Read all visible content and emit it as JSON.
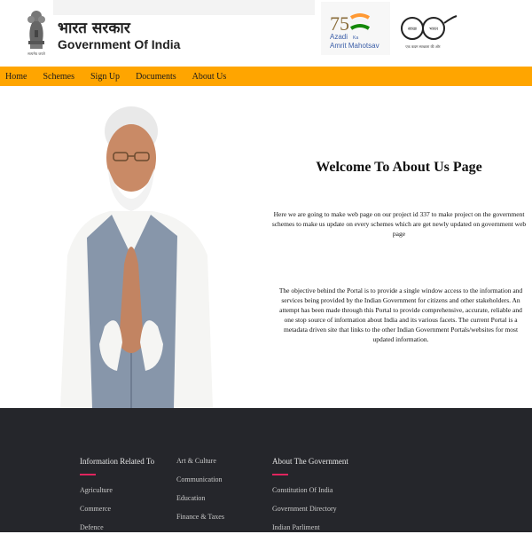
{
  "header": {
    "hindi_title": "भारत सरकार",
    "english_title": "Government Of India",
    "emblem_caption": "सत्यमेव जयते",
    "azadi": {
      "number": "75",
      "line1": "Azadi",
      "line2": "Ka",
      "line3": "Amrit Mahotsav"
    },
    "swachh": {
      "left": "स्वच्छ",
      "right": "भारत",
      "tagline": "एक कदम स्वच्छता की ओर"
    }
  },
  "nav": {
    "items": [
      {
        "label": "Home"
      },
      {
        "label": "Schemes"
      },
      {
        "label": "Sign Up"
      },
      {
        "label": "Documents"
      },
      {
        "label": "About Us"
      }
    ]
  },
  "main": {
    "welcome_heading": "Welcome To About Us Page",
    "intro_text": "Here we are going to make web page on our project id 337 to make project on the government schemes to make us update on every schemes which are get newly updated on government web page",
    "objective_text": "The objective behind the Portal is to provide a single window access to the information and services being provided by the Indian Government for citizens and other stakeholders. An attempt has been made through this Portal to provide comprehensive, accurate, reliable and one stop source of information about India and its various facets. The current Portal is a metadata driven site that links to the other Indian Government Portals/websites for most updated information."
  },
  "footer": {
    "col1": {
      "title": "Information Related To",
      "links": [
        "Agriculture",
        "Commerce",
        "Defence"
      ]
    },
    "col2": {
      "links": [
        "Art & Culture",
        "Communication",
        "Education",
        "Finance & Taxes"
      ]
    },
    "col3": {
      "title": "About The Government",
      "links": [
        "Constitution Of India",
        "Government Directory",
        "Indian Parliment"
      ]
    }
  },
  "colors": {
    "nav_bg": "#ffa500",
    "footer_bg": "#25262b",
    "accent_underline": "#e0245e"
  }
}
